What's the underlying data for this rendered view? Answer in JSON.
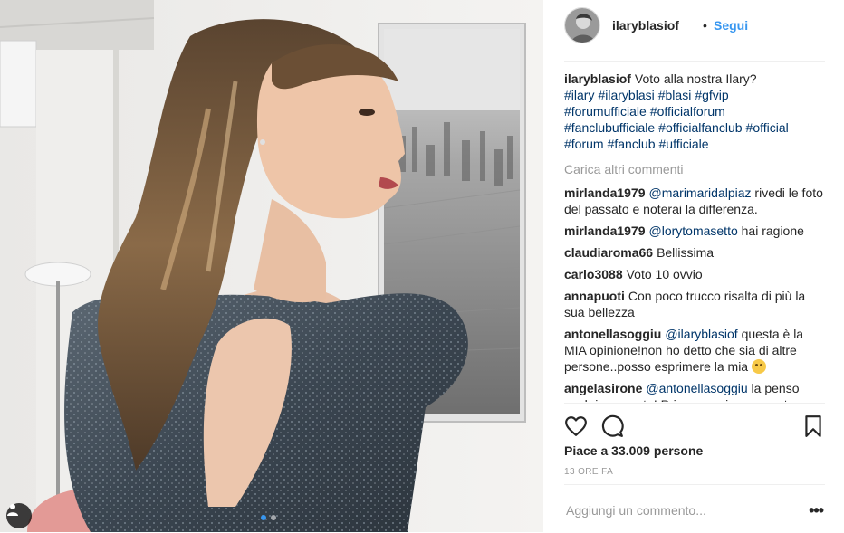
{
  "post": {
    "username": "ilaryblasiof",
    "separator": "•",
    "follow_label": "Segui",
    "caption_text": "Voto alla nostra Ilary?",
    "hashtags": [
      "#ilary",
      "#ilaryblasi",
      "#blasi",
      "#gfvip",
      "#forumufficiale",
      "#officialforum",
      "#fanclubufficiale",
      "#officialfanclub",
      "#official",
      "#forum",
      "#fanclub",
      "#ufficiale"
    ],
    "load_more_label": "Carica altri commenti",
    "comments": [
      {
        "user": "mirlanda1979",
        "mention": "@marimaridalpiaz",
        "text": " rivedi le foto del passato e noterai la differenza.",
        "emoji": ""
      },
      {
        "user": "mirlanda1979",
        "mention": "@lorytomasetto",
        "text": " hai ragione",
        "emoji": ""
      },
      {
        "user": "claudiaroma66",
        "mention": "",
        "text": "Bellissima",
        "emoji": ""
      },
      {
        "user": "carlo3088",
        "mention": "",
        "text": "Voto 10 ovvio",
        "emoji": ""
      },
      {
        "user": "annapuoti",
        "mention": "",
        "text": "Con poco trucco risalta di più la sua bellezza",
        "emoji": ""
      },
      {
        "user": "antonellasoggiu",
        "mention": "@ilaryblasiof",
        "text": " questa è la MIA opinione!non ho detto che sia di altre persone..posso esprimere la mia ",
        "emoji": "grimacing-face"
      },
      {
        "user": "angelasirone",
        "mention": "@antonellasoggiu",
        "text": " la penso anch io come te! Prima ammiravo questa",
        "emoji": ""
      }
    ],
    "likes_label": "Piace a 33.009 persone",
    "time_label": "13 ORE FA",
    "add_comment_placeholder": "Aggiungi un commento...",
    "more_label": "•••",
    "icons": [
      "heart-icon",
      "comment-icon",
      "bookmark-icon",
      "user-tag-icon"
    ],
    "carousel": {
      "count": 2,
      "active": 1
    },
    "colors": {
      "link": "#3897f0",
      "hashtag": "#003569",
      "muted": "#999999",
      "text": "#262626"
    }
  }
}
